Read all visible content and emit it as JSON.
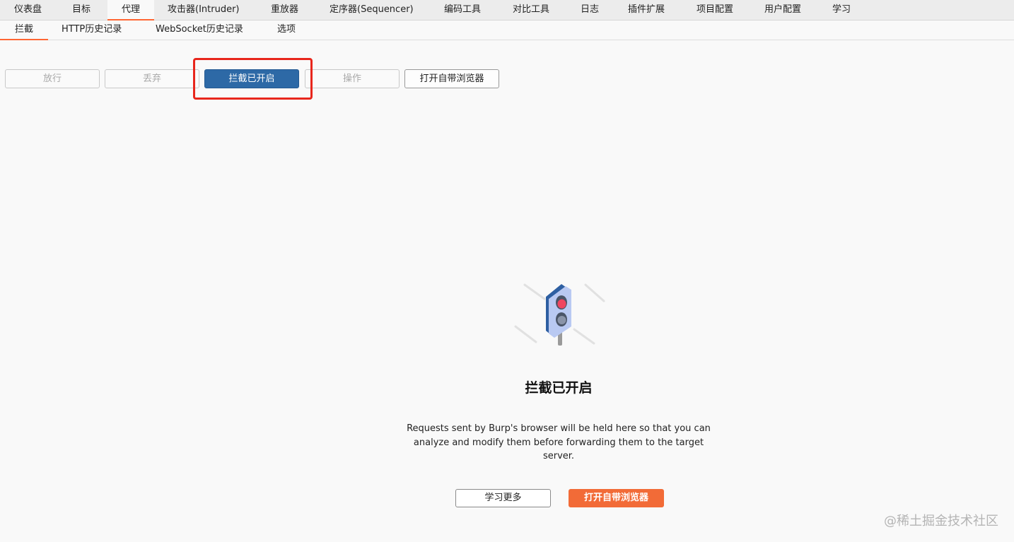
{
  "main_tabs": [
    {
      "label": "仪表盘",
      "active": false
    },
    {
      "label": "目标",
      "active": false
    },
    {
      "label": "代理",
      "active": true
    },
    {
      "label": "攻击器(Intruder)",
      "active": false
    },
    {
      "label": "重放器",
      "active": false
    },
    {
      "label": "定序器(Sequencer)",
      "active": false
    },
    {
      "label": "编码工具",
      "active": false
    },
    {
      "label": "对比工具",
      "active": false
    },
    {
      "label": "日志",
      "active": false
    },
    {
      "label": "插件扩展",
      "active": false
    },
    {
      "label": "项目配置",
      "active": false
    },
    {
      "label": "用户配置",
      "active": false
    },
    {
      "label": "学习",
      "active": false
    }
  ],
  "sub_tabs": [
    {
      "label": "拦截",
      "active": true
    },
    {
      "label": "HTTP历史记录",
      "active": false
    },
    {
      "label": "WebSocket历史记录",
      "active": false
    },
    {
      "label": "选项",
      "active": false
    }
  ],
  "toolbar": {
    "forward_label": "放行",
    "drop_label": "丢弃",
    "intercept_toggle_label": "拦截已开启",
    "action_label": "操作",
    "open_browser_label": "打开自带浏览器"
  },
  "empty_state": {
    "title": "拦截已开启",
    "description": "Requests sent by Burp's browser will be held here so that you can analyze and modify them before forwarding them to the target server.",
    "learn_more_label": "学习更多",
    "open_browser_label": "打开自带浏览器"
  },
  "watermark": "@稀土掘金技术社区",
  "colors": {
    "accent": "#ff6633",
    "primary_button": "#2d69a6",
    "cta_button": "#f26b37",
    "highlight": "#e8261c"
  }
}
